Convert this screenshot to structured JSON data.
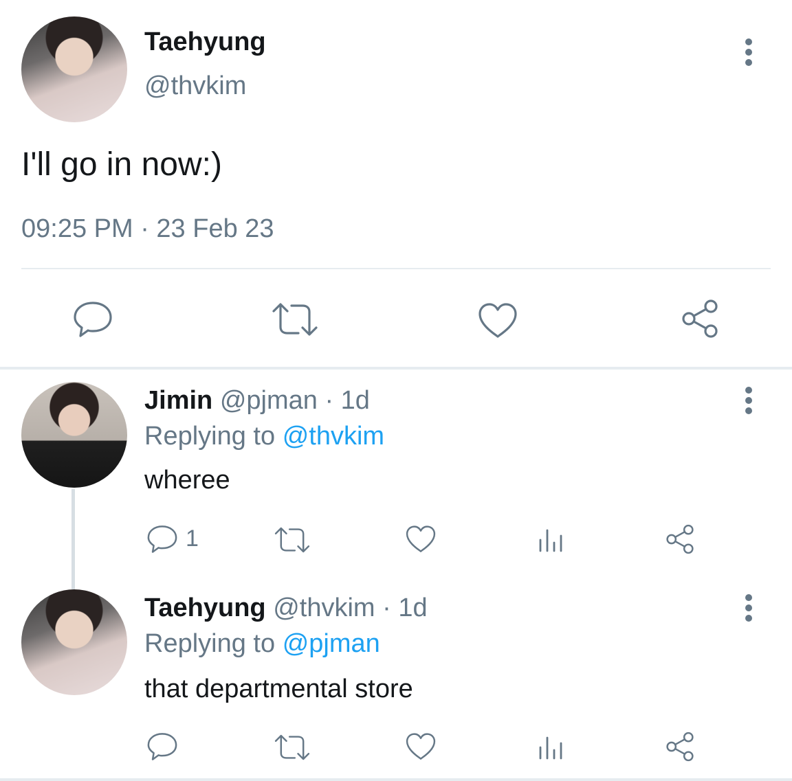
{
  "main_tweet": {
    "display_name": "Taehyung",
    "handle": "@thvkim",
    "text": "I'll go in now:)",
    "timestamp": "09:25 PM · 23 Feb 23",
    "icons": [
      "reply-icon",
      "retweet-icon",
      "like-icon",
      "share-icon",
      "more-options-icon"
    ]
  },
  "replies": [
    {
      "display_name": "Jimin",
      "handle": "@pjman",
      "time": "· 1d",
      "replying_prefix": "Replying to",
      "replying_to": "@thvkim",
      "text": "wheree",
      "reply_count": "1"
    },
    {
      "display_name": "Taehyung",
      "handle": "@thvkim",
      "time": "· 1d",
      "replying_prefix": "Replying to",
      "replying_to": "@pjman",
      "text": "that departmental store",
      "reply_count": ""
    }
  ],
  "colors": {
    "text": "#14171a",
    "muted": "#657786",
    "link": "#1da1f2",
    "divider": "#e6ecf0"
  }
}
